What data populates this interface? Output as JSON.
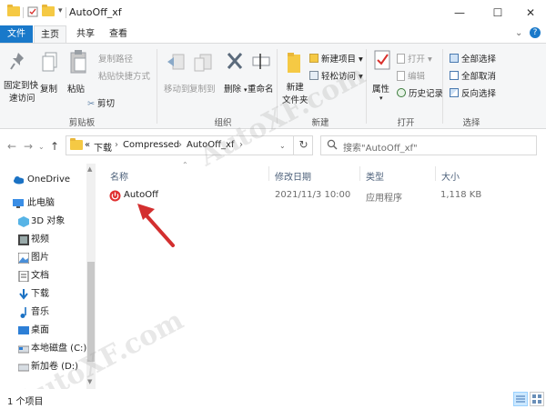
{
  "window": {
    "title": "AutoOff_xf",
    "minimize": "—",
    "maximize": "☐",
    "close": "✕"
  },
  "tabs": [
    {
      "label": "文件"
    },
    {
      "label": "主页"
    },
    {
      "label": "共享"
    },
    {
      "label": "查看"
    }
  ],
  "ribbon": {
    "clipboard": {
      "pin_label_1": "固定到快",
      "pin_label_2": "速访问",
      "copy_label": "复制",
      "paste_label": "粘贴",
      "copy_path_label": "复制路径",
      "paste_shortcut_label": "粘贴快捷方式",
      "cut_label": "剪切",
      "group_label": "剪贴板"
    },
    "organize": {
      "move_label": "移动到",
      "copy_to_label": "复制到",
      "delete_label": "删除",
      "rename_label": "重命名",
      "group_label": "组织"
    },
    "new": {
      "new_folder_1": "新建",
      "new_folder_2": "文件夹",
      "new_item_label": "新建项目 ▾",
      "easy_access_label": "轻松访问 ▾",
      "group_label": "新建"
    },
    "open": {
      "properties_label": "属性",
      "open_label": "打开 ▾",
      "edit_label": "编辑",
      "history_label": "历史记录",
      "group_label": "打开"
    },
    "select": {
      "select_all_label": "全部选择",
      "select_none_label": "全部取消",
      "invert_label": "反向选择",
      "group_label": "选择"
    }
  },
  "address": {
    "prefix": "«",
    "crumbs": [
      "下载",
      "Compressed",
      "AutoOff_xf"
    ],
    "sep": "›",
    "search_placeholder": "搜索\"AutoOff_xf\""
  },
  "nav": {
    "items": [
      {
        "label": "OneDrive",
        "icon": "cloud-icon"
      },
      {
        "label": "此电脑",
        "icon": "computer-icon"
      },
      {
        "label": "3D 对象",
        "icon": "3d-objects-icon"
      },
      {
        "label": "视频",
        "icon": "video-icon"
      },
      {
        "label": "图片",
        "icon": "pictures-icon"
      },
      {
        "label": "文档",
        "icon": "documents-icon"
      },
      {
        "label": "下载",
        "icon": "download-icon"
      },
      {
        "label": "音乐",
        "icon": "music-icon"
      },
      {
        "label": "桌面",
        "icon": "desktop-icon"
      },
      {
        "label": "本地磁盘 (C:)",
        "icon": "drive-icon"
      },
      {
        "label": "新加卷 (D:)",
        "icon": "drive-icon"
      }
    ]
  },
  "columns": {
    "name": "名称",
    "modified": "修改日期",
    "type": "类型",
    "size": "大小"
  },
  "files": [
    {
      "name": "AutoOff",
      "modified": "2021/11/3 10:00",
      "type": "应用程序",
      "size": "1,118 KB"
    }
  ],
  "status": {
    "count": "1 个项目"
  },
  "colors": {
    "accent": "#1979ca",
    "arrow": "#d32f2f"
  }
}
